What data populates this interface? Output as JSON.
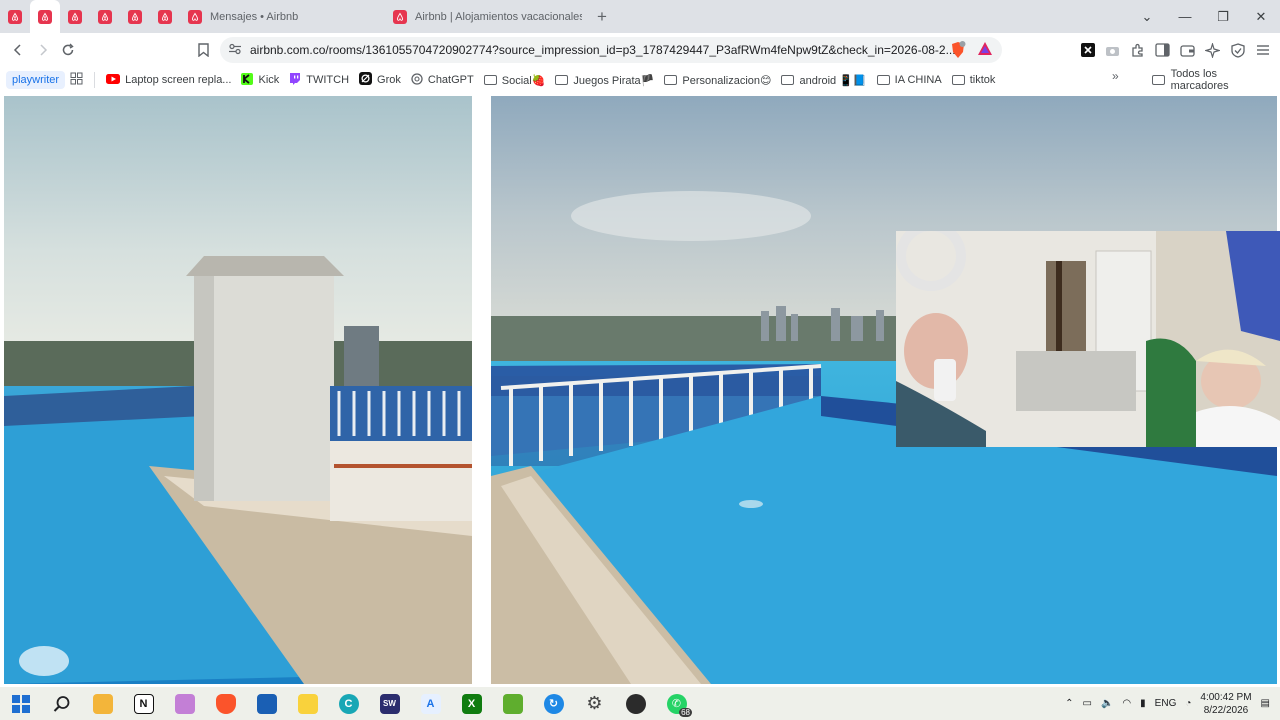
{
  "tabs": {
    "pinned_count": 6,
    "active_pinned_index": 1,
    "items": [
      {
        "title": "Mensajes • Airbnb",
        "icon": "airbnb-icon"
      },
      {
        "title": "Airbnb | Alojamientos vacacionales y",
        "icon": "airbnb-icon"
      }
    ],
    "new_tab_label": "+"
  },
  "toolbar": {
    "url": "airbnb.com.co/rooms/1361055704720902774?source_impression_id=p3_1787429447_P3afRWm4feNpw9tZ&check_in=2026-08-2..."
  },
  "bookmarks": {
    "items": [
      {
        "label": "playwriter",
        "kind": "chip"
      },
      {
        "label": "",
        "kind": "apps"
      },
      {
        "label": "Laptop screen repla...",
        "kind": "youtube"
      },
      {
        "label": "Kick",
        "kind": "kick"
      },
      {
        "label": "TWITCH",
        "kind": "twitch"
      },
      {
        "label": "Grok",
        "kind": "grok"
      },
      {
        "label": "ChatGPT",
        "kind": "chatgpt"
      },
      {
        "label": "Social🍓",
        "kind": "folder"
      },
      {
        "label": "Juegos Pirata🏴",
        "kind": "folder"
      },
      {
        "label": "Personalizacion😊",
        "kind": "folder"
      },
      {
        "label": "android 📱📘",
        "kind": "folder"
      },
      {
        "label": "IA CHINA",
        "kind": "folder"
      },
      {
        "label": "tiktok",
        "kind": "folder"
      }
    ],
    "more": "»",
    "all_bookmarks": "Todos los marcadores"
  },
  "taskbar": {
    "apps": [
      {
        "name": "start-icon",
        "color": "#0078d4",
        "glyph": "⊞"
      },
      {
        "name": "search-icon",
        "color": "",
        "glyph": "⌕"
      },
      {
        "name": "file-explorer-icon",
        "color": "#f3b53a",
        "glyph": ""
      },
      {
        "name": "notion-icon",
        "color": "#ffffff",
        "glyph": "N"
      },
      {
        "name": "app-bear-icon",
        "color": "#c37fd6",
        "glyph": ""
      },
      {
        "name": "brave-icon",
        "color": "#fb542b",
        "glyph": ""
      },
      {
        "name": "store-icon",
        "color": "#1a5fb4",
        "glyph": ""
      },
      {
        "name": "sticky-notes-icon",
        "color": "#f9d23c",
        "glyph": ""
      },
      {
        "name": "app-c-icon",
        "color": "#18a7b5",
        "glyph": "C"
      },
      {
        "name": "app-sw-icon",
        "color": "#2b2d6e",
        "glyph": "SW"
      },
      {
        "name": "app-a-icon",
        "color": "#e6f0ff",
        "glyph": "A"
      },
      {
        "name": "xbox-icon",
        "color": "#107c10",
        "glyph": "X"
      },
      {
        "name": "app-leaf-icon",
        "color": "#5fae2e",
        "glyph": ""
      },
      {
        "name": "sync-icon",
        "color": "#1e88e5",
        "glyph": "↻"
      },
      {
        "name": "settings-icon",
        "color": "#6b6b6b",
        "glyph": "⚙"
      },
      {
        "name": "app-ball-icon",
        "color": "#2b2b2b",
        "glyph": "●"
      },
      {
        "name": "whatsapp-icon",
        "color": "#25d366",
        "glyph": "✆",
        "badge": "68"
      }
    ],
    "language": "ENG",
    "time": "4:00:42 PM",
    "date": "8/22/2026"
  }
}
